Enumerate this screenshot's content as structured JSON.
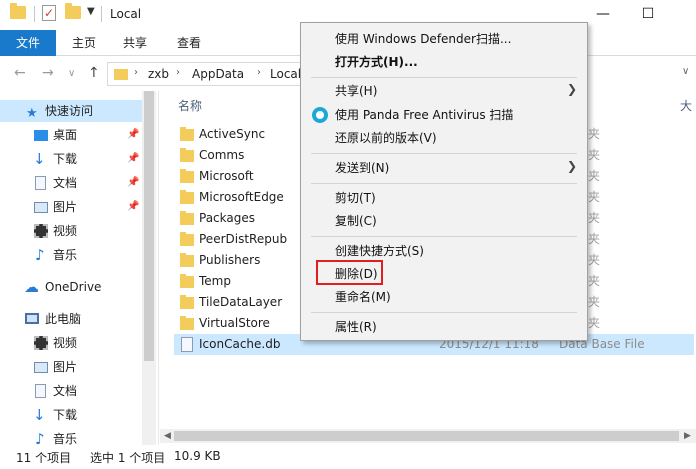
{
  "window": {
    "title": "Local",
    "minimize": "—",
    "maximize": "☐"
  },
  "ribbon": {
    "tabs": [
      "文件",
      "主页",
      "共享",
      "查看"
    ]
  },
  "address": {
    "parts": [
      "zxb",
      "AppData",
      "Local"
    ]
  },
  "navpane": {
    "quick_access": "快速访问",
    "items": [
      "桌面",
      "下载",
      "文档",
      "图片",
      "视频",
      "音乐"
    ],
    "onedrive": "OneDrive",
    "this_pc": "此电脑",
    "pc_items": [
      "视频",
      "图片",
      "文档",
      "下载",
      "音乐"
    ]
  },
  "filelist": {
    "column_name": "名称",
    "column_size_partial": "大",
    "folders": [
      "ActiveSync",
      "Comms",
      "Microsoft",
      "MicrosoftEdge",
      "Packages",
      "PeerDistRepub",
      "Publishers",
      "Temp",
      "TileDataLayer",
      "VirtualStore"
    ],
    "folder_type_partial": "夹",
    "selected_file": {
      "name": "IconCache.db",
      "date": "2015/12/1 11:18",
      "type": "Data Base File"
    }
  },
  "status": {
    "count": "11 个项目",
    "selected": "选中 1 个项目",
    "size": "10.9 KB"
  },
  "context_menu": {
    "scan_defender": "使用 Windows Defender扫描...",
    "open_with": "打开方式(H)...",
    "share": "共享(H)",
    "scan_panda": "使用 Panda Free Antivirus 扫描",
    "restore": "还原以前的版本(V)",
    "send_to": "发送到(N)",
    "cut": "剪切(T)",
    "copy": "复制(C)",
    "shortcut": "创建快捷方式(S)",
    "delete": "删除(D)",
    "rename": "重命名(M)",
    "properties": "属性(R)"
  },
  "colors": {
    "accent": "#1979ca",
    "selection": "#cce8ff",
    "highlight_box": "#e02020"
  }
}
